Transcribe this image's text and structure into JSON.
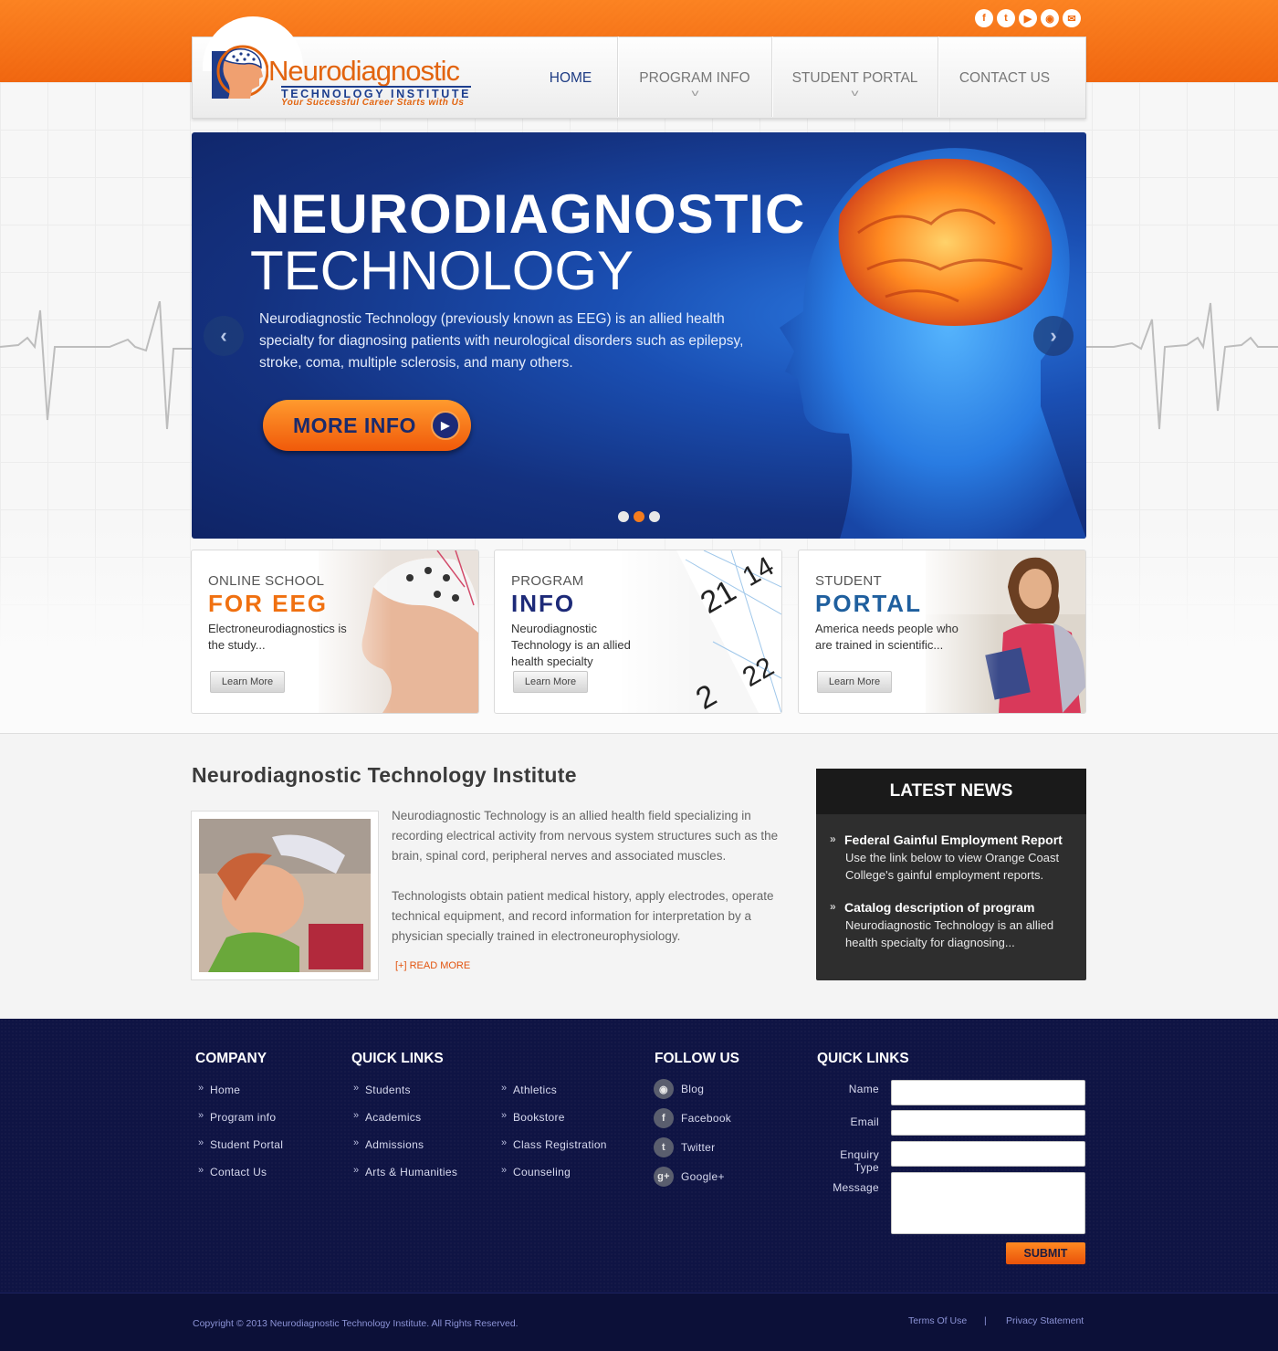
{
  "social_icons": [
    "facebook-icon",
    "twitter-icon",
    "youtube-icon",
    "rss-icon",
    "email-icon"
  ],
  "logo": {
    "name": "Neurodiagnostic",
    "subtitle": "TECHNOLOGY INSTITUTE",
    "tagline": "Your Successful Career Starts with Us"
  },
  "nav": [
    {
      "label": "HOME",
      "dropdown": false,
      "active": true
    },
    {
      "label": "PROGRAM INFO",
      "dropdown": true
    },
    {
      "label": "STUDENT PORTAL",
      "dropdown": true
    },
    {
      "label": "CONTACT US",
      "dropdown": false
    }
  ],
  "hero": {
    "title_line1": "NEURODIAGNOSTIC",
    "title_line2": "TECHNOLOGY",
    "text": "Neurodiagnostic Technology (previously known as EEG) is an allied health specialty for diagnosing patients with neurological disorders such as epilepsy, stroke, coma, multiple sclerosis, and many others.",
    "button": "MORE INFO",
    "slides": 3,
    "active_slide": 2
  },
  "cards": [
    {
      "kicker": "ONLINE SCHOOL",
      "title": "FOR EEG",
      "title_color": "#f07010",
      "desc": "Electroneurodiagnostics is the study...",
      "button": "Learn More"
    },
    {
      "kicker": "PROGRAM",
      "title": "INFO",
      "title_color": "#1d2a78",
      "desc": "Neurodiagnostic Technology is an allied health specialty",
      "button": "Learn More"
    },
    {
      "kicker": "STUDENT",
      "title": "PORTAL",
      "title_color": "#1f5f9e",
      "desc": "America needs people who are trained in scientific...",
      "button": "Learn More"
    }
  ],
  "about": {
    "title": "Neurodiagnostic Technology Institute",
    "p1": "Neurodiagnostic Technology is an allied health field specializing in recording electrical activity from nervous system structures such as the brain, spinal cord, peripheral nerves and associated muscles.",
    "p2": "Technologists obtain patient medical history, apply electrodes, operate technical equipment, and record information for interpretation by a physician specially trained in electroneurophysiology.",
    "read_more": "[+] READ MORE"
  },
  "news": {
    "heading": "LATEST NEWS",
    "items": [
      {
        "title": "Federal Gainful Employment Report",
        "desc": "Use the link below to view Orange Coast College's gainful employment reports."
      },
      {
        "title": "Catalog description of program",
        "desc": "Neurodiagnostic Technology is an allied health specialty for diagnosing..."
      }
    ]
  },
  "footer": {
    "company": {
      "heading": "COMPANY",
      "links": [
        "Home",
        "Program info",
        "Student Portal",
        "Contact Us"
      ]
    },
    "quick_links": {
      "heading": "QUICK LINKS",
      "col1": [
        "Students",
        "Academics",
        "Admissions",
        "Arts & Humanities"
      ],
      "col2": [
        "Athletics",
        "Bookstore",
        "Class Registration",
        "Counseling"
      ]
    },
    "follow": {
      "heading": "FOLLOW US",
      "items": [
        {
          "label": "Blog",
          "icon": "rss-icon"
        },
        {
          "label": "Facebook",
          "icon": "facebook-icon"
        },
        {
          "label": "Twitter",
          "icon": "twitter-icon"
        },
        {
          "label": "Google+",
          "icon": "google-plus-icon"
        }
      ]
    },
    "form": {
      "heading": "QUICK LINKS",
      "name_label": "Name",
      "email_label": "Email",
      "enquiry_label": "Enquiry Type",
      "message_label": "Message",
      "submit": "SUBMIT"
    }
  },
  "bottom": {
    "copyright": "Copyright © 2013 Neurodiagnostic Technology Institute. All Rights Reserved.",
    "terms": "Terms Of Use",
    "separator": "|",
    "privacy": "Privacy Statement"
  }
}
